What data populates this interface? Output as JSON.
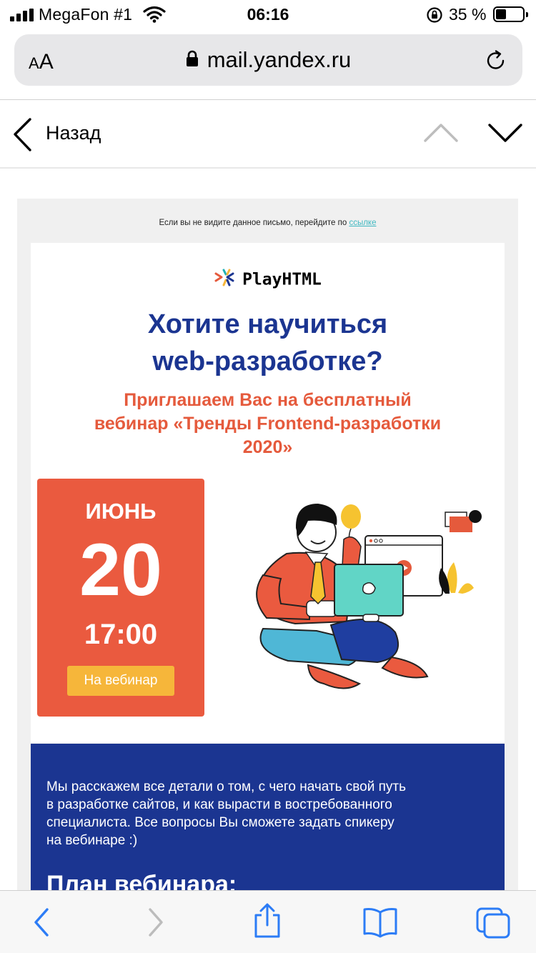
{
  "status_bar": {
    "carrier": "MegaFon #1",
    "time": "06:16",
    "battery": "35 %"
  },
  "browser": {
    "text_size_button": "AA",
    "url": "mail.yandex.ru"
  },
  "mail_nav": {
    "back_label": "Назад"
  },
  "email": {
    "preheader_text": "Если вы не видите данное письмо, перейдите по",
    "preheader_link": "ссылке",
    "brand": "PlayHTML",
    "headline_line1": "Хотите научиться",
    "headline_line2": "web-разработке?",
    "subhead_line1": "Приглашаем Вас на бесплатный",
    "subhead_line2": "вебинар «Тренды Frontend-разработки",
    "subhead_line3": "2020»",
    "date": {
      "month": "ИЮНЬ",
      "day": "20",
      "time": "17:00",
      "button": "На вебинар"
    },
    "intro_line1": "Мы расскажем все детали о том, с чего начать свой путь",
    "intro_line2": "в разработке сайтов, и как вырасти в востребованного",
    "intro_line3": "специалиста. Все вопросы Вы сможете задать спикеру",
    "intro_line4": "на вебинаре :)",
    "plan_title": "План вебинара:"
  },
  "colors": {
    "headline_blue": "#1b3591",
    "accent_red": "#ea5a3f",
    "button_yellow": "#f6b63a",
    "safari_blue": "#2c7cf6"
  },
  "icons": {
    "status": [
      "signal-icon",
      "wifi-icon",
      "rotation-lock-icon",
      "battery-icon"
    ],
    "browser": [
      "lock-icon",
      "reload-icon"
    ],
    "nav": [
      "chevron-left-icon",
      "chevron-up-icon",
      "chevron-down-icon"
    ],
    "toolbar": [
      "back-icon",
      "forward-icon",
      "share-icon",
      "bookmarks-icon",
      "tabs-icon"
    ]
  }
}
